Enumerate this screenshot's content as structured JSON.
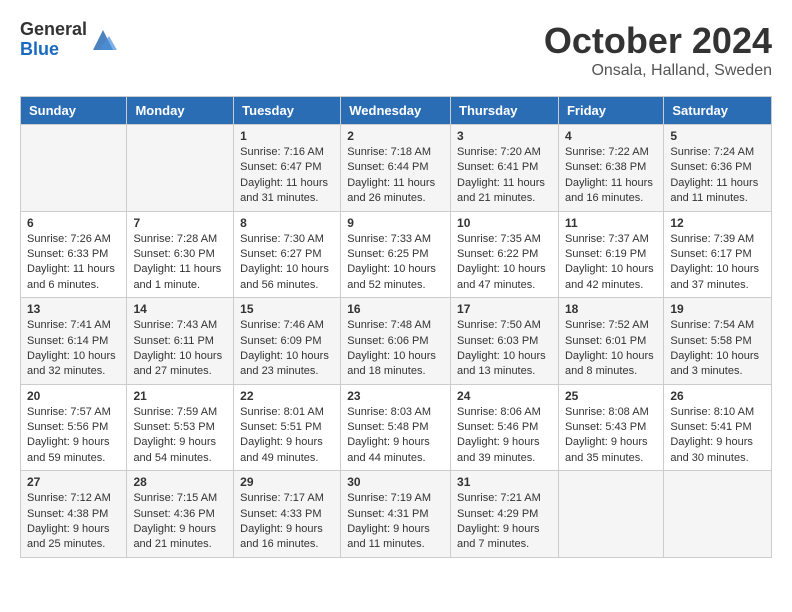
{
  "logo": {
    "general": "General",
    "blue": "Blue"
  },
  "title": "October 2024",
  "location": "Onsala, Halland, Sweden",
  "days_of_week": [
    "Sunday",
    "Monday",
    "Tuesday",
    "Wednesday",
    "Thursday",
    "Friday",
    "Saturday"
  ],
  "weeks": [
    [
      {
        "day": "",
        "sunrise": "",
        "sunset": "",
        "daylight": ""
      },
      {
        "day": "",
        "sunrise": "",
        "sunset": "",
        "daylight": ""
      },
      {
        "day": "1",
        "sunrise": "Sunrise: 7:16 AM",
        "sunset": "Sunset: 6:47 PM",
        "daylight": "Daylight: 11 hours and 31 minutes."
      },
      {
        "day": "2",
        "sunrise": "Sunrise: 7:18 AM",
        "sunset": "Sunset: 6:44 PM",
        "daylight": "Daylight: 11 hours and 26 minutes."
      },
      {
        "day": "3",
        "sunrise": "Sunrise: 7:20 AM",
        "sunset": "Sunset: 6:41 PM",
        "daylight": "Daylight: 11 hours and 21 minutes."
      },
      {
        "day": "4",
        "sunrise": "Sunrise: 7:22 AM",
        "sunset": "Sunset: 6:38 PM",
        "daylight": "Daylight: 11 hours and 16 minutes."
      },
      {
        "day": "5",
        "sunrise": "Sunrise: 7:24 AM",
        "sunset": "Sunset: 6:36 PM",
        "daylight": "Daylight: 11 hours and 11 minutes."
      }
    ],
    [
      {
        "day": "6",
        "sunrise": "Sunrise: 7:26 AM",
        "sunset": "Sunset: 6:33 PM",
        "daylight": "Daylight: 11 hours and 6 minutes."
      },
      {
        "day": "7",
        "sunrise": "Sunrise: 7:28 AM",
        "sunset": "Sunset: 6:30 PM",
        "daylight": "Daylight: 11 hours and 1 minute."
      },
      {
        "day": "8",
        "sunrise": "Sunrise: 7:30 AM",
        "sunset": "Sunset: 6:27 PM",
        "daylight": "Daylight: 10 hours and 56 minutes."
      },
      {
        "day": "9",
        "sunrise": "Sunrise: 7:33 AM",
        "sunset": "Sunset: 6:25 PM",
        "daylight": "Daylight: 10 hours and 52 minutes."
      },
      {
        "day": "10",
        "sunrise": "Sunrise: 7:35 AM",
        "sunset": "Sunset: 6:22 PM",
        "daylight": "Daylight: 10 hours and 47 minutes."
      },
      {
        "day": "11",
        "sunrise": "Sunrise: 7:37 AM",
        "sunset": "Sunset: 6:19 PM",
        "daylight": "Daylight: 10 hours and 42 minutes."
      },
      {
        "day": "12",
        "sunrise": "Sunrise: 7:39 AM",
        "sunset": "Sunset: 6:17 PM",
        "daylight": "Daylight: 10 hours and 37 minutes."
      }
    ],
    [
      {
        "day": "13",
        "sunrise": "Sunrise: 7:41 AM",
        "sunset": "Sunset: 6:14 PM",
        "daylight": "Daylight: 10 hours and 32 minutes."
      },
      {
        "day": "14",
        "sunrise": "Sunrise: 7:43 AM",
        "sunset": "Sunset: 6:11 PM",
        "daylight": "Daylight: 10 hours and 27 minutes."
      },
      {
        "day": "15",
        "sunrise": "Sunrise: 7:46 AM",
        "sunset": "Sunset: 6:09 PM",
        "daylight": "Daylight: 10 hours and 23 minutes."
      },
      {
        "day": "16",
        "sunrise": "Sunrise: 7:48 AM",
        "sunset": "Sunset: 6:06 PM",
        "daylight": "Daylight: 10 hours and 18 minutes."
      },
      {
        "day": "17",
        "sunrise": "Sunrise: 7:50 AM",
        "sunset": "Sunset: 6:03 PM",
        "daylight": "Daylight: 10 hours and 13 minutes."
      },
      {
        "day": "18",
        "sunrise": "Sunrise: 7:52 AM",
        "sunset": "Sunset: 6:01 PM",
        "daylight": "Daylight: 10 hours and 8 minutes."
      },
      {
        "day": "19",
        "sunrise": "Sunrise: 7:54 AM",
        "sunset": "Sunset: 5:58 PM",
        "daylight": "Daylight: 10 hours and 3 minutes."
      }
    ],
    [
      {
        "day": "20",
        "sunrise": "Sunrise: 7:57 AM",
        "sunset": "Sunset: 5:56 PM",
        "daylight": "Daylight: 9 hours and 59 minutes."
      },
      {
        "day": "21",
        "sunrise": "Sunrise: 7:59 AM",
        "sunset": "Sunset: 5:53 PM",
        "daylight": "Daylight: 9 hours and 54 minutes."
      },
      {
        "day": "22",
        "sunrise": "Sunrise: 8:01 AM",
        "sunset": "Sunset: 5:51 PM",
        "daylight": "Daylight: 9 hours and 49 minutes."
      },
      {
        "day": "23",
        "sunrise": "Sunrise: 8:03 AM",
        "sunset": "Sunset: 5:48 PM",
        "daylight": "Daylight: 9 hours and 44 minutes."
      },
      {
        "day": "24",
        "sunrise": "Sunrise: 8:06 AM",
        "sunset": "Sunset: 5:46 PM",
        "daylight": "Daylight: 9 hours and 39 minutes."
      },
      {
        "day": "25",
        "sunrise": "Sunrise: 8:08 AM",
        "sunset": "Sunset: 5:43 PM",
        "daylight": "Daylight: 9 hours and 35 minutes."
      },
      {
        "day": "26",
        "sunrise": "Sunrise: 8:10 AM",
        "sunset": "Sunset: 5:41 PM",
        "daylight": "Daylight: 9 hours and 30 minutes."
      }
    ],
    [
      {
        "day": "27",
        "sunrise": "Sunrise: 7:12 AM",
        "sunset": "Sunset: 4:38 PM",
        "daylight": "Daylight: 9 hours and 25 minutes."
      },
      {
        "day": "28",
        "sunrise": "Sunrise: 7:15 AM",
        "sunset": "Sunset: 4:36 PM",
        "daylight": "Daylight: 9 hours and 21 minutes."
      },
      {
        "day": "29",
        "sunrise": "Sunrise: 7:17 AM",
        "sunset": "Sunset: 4:33 PM",
        "daylight": "Daylight: 9 hours and 16 minutes."
      },
      {
        "day": "30",
        "sunrise": "Sunrise: 7:19 AM",
        "sunset": "Sunset: 4:31 PM",
        "daylight": "Daylight: 9 hours and 11 minutes."
      },
      {
        "day": "31",
        "sunrise": "Sunrise: 7:21 AM",
        "sunset": "Sunset: 4:29 PM",
        "daylight": "Daylight: 9 hours and 7 minutes."
      },
      {
        "day": "",
        "sunrise": "",
        "sunset": "",
        "daylight": ""
      },
      {
        "day": "",
        "sunrise": "",
        "sunset": "",
        "daylight": ""
      }
    ]
  ]
}
